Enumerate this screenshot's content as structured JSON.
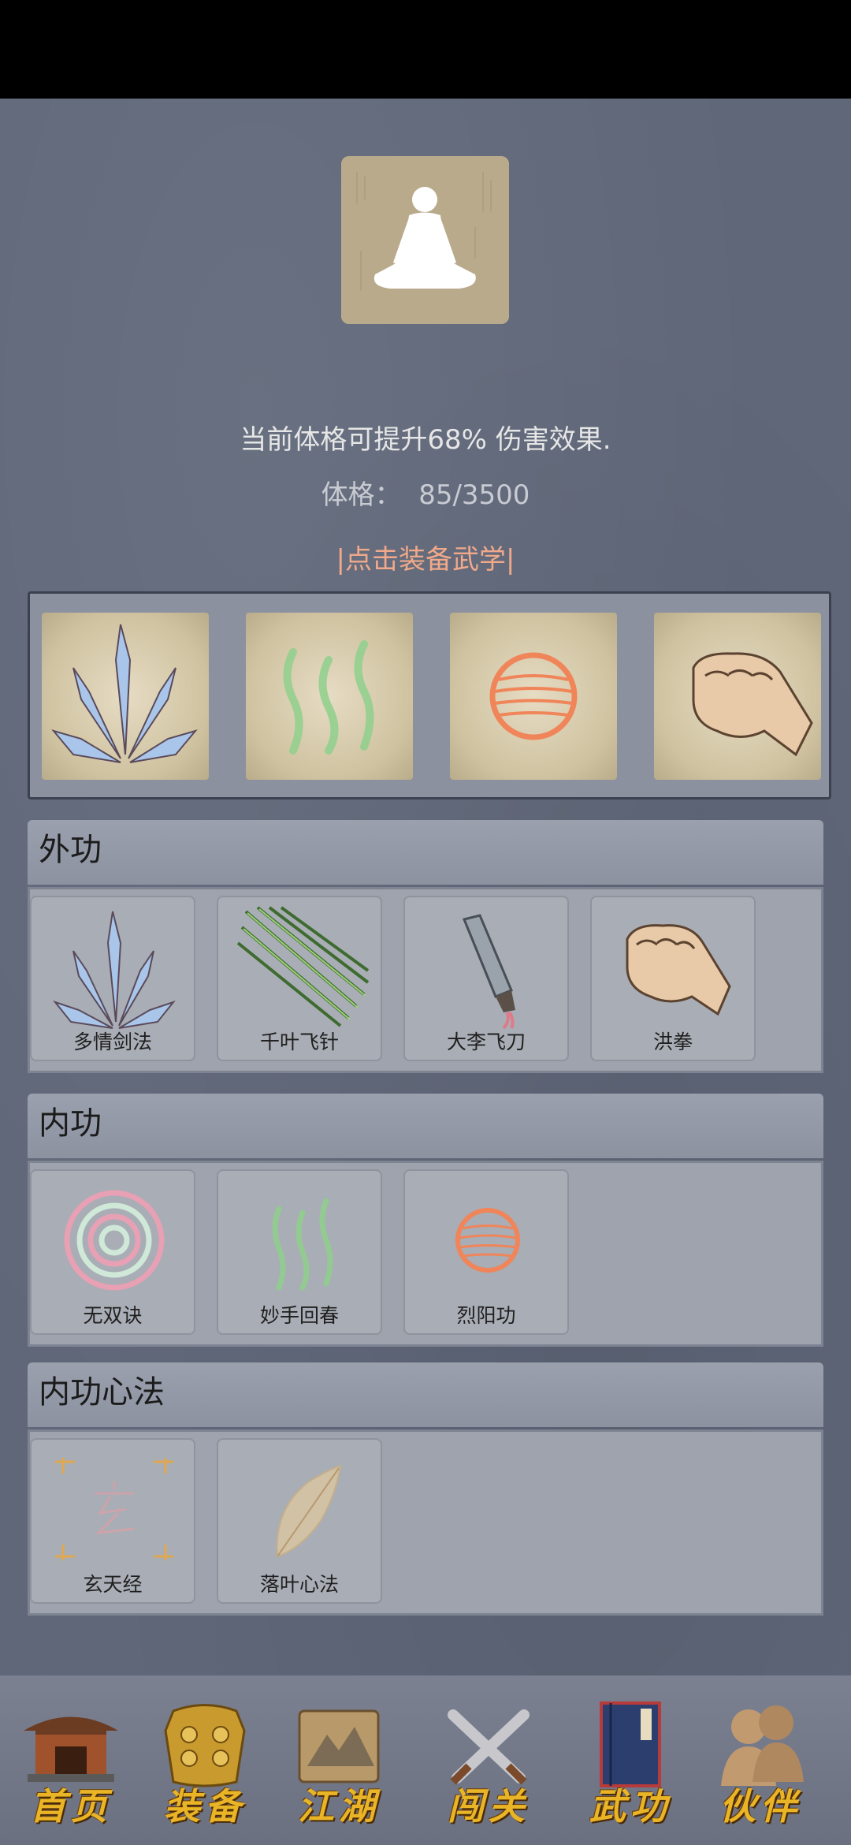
{
  "info": {
    "bonus_text": "当前体格可提升68% 伤害效果.",
    "stat_label": "体格：",
    "stat_value": "85/3500",
    "equip_link": "|点击装备武学|"
  },
  "equipped": [
    {
      "icon": "crystal-sword-icon"
    },
    {
      "icon": "green-waves-icon"
    },
    {
      "icon": "fire-orb-icon"
    },
    {
      "icon": "fist-icon"
    }
  ],
  "sections": [
    {
      "title": "外功",
      "skills": [
        {
          "name": "多情剑法",
          "icon": "crystal-sword-icon"
        },
        {
          "name": "千叶飞针",
          "icon": "flying-needles-icon"
        },
        {
          "name": "大李飞刀",
          "icon": "flying-knife-icon"
        },
        {
          "name": "洪拳",
          "icon": "fist-icon"
        }
      ]
    },
    {
      "title": "内功",
      "skills": [
        {
          "name": "无双诀",
          "icon": "spiral-icon"
        },
        {
          "name": "妙手回春",
          "icon": "green-waves-icon"
        },
        {
          "name": "烈阳功",
          "icon": "fire-orb-icon"
        }
      ]
    },
    {
      "title": "内功心法",
      "skills": [
        {
          "name": "玄天经",
          "icon": "xuan-scroll-icon"
        },
        {
          "name": "落叶心法",
          "icon": "leaf-icon"
        }
      ]
    }
  ],
  "nav": [
    {
      "label": "首页",
      "icon": "temple-icon"
    },
    {
      "label": "装备",
      "icon": "armor-icon"
    },
    {
      "label": "江湖",
      "icon": "map-scroll-icon"
    },
    {
      "label": "闯关",
      "icon": "crossed-swords-icon"
    },
    {
      "label": "武功",
      "icon": "book-icon"
    },
    {
      "label": "伙伴",
      "icon": "partners-icon"
    }
  ],
  "colors": {
    "background": "#5f6779",
    "link": "#f1a98a",
    "nav_label": "#e9b526"
  }
}
